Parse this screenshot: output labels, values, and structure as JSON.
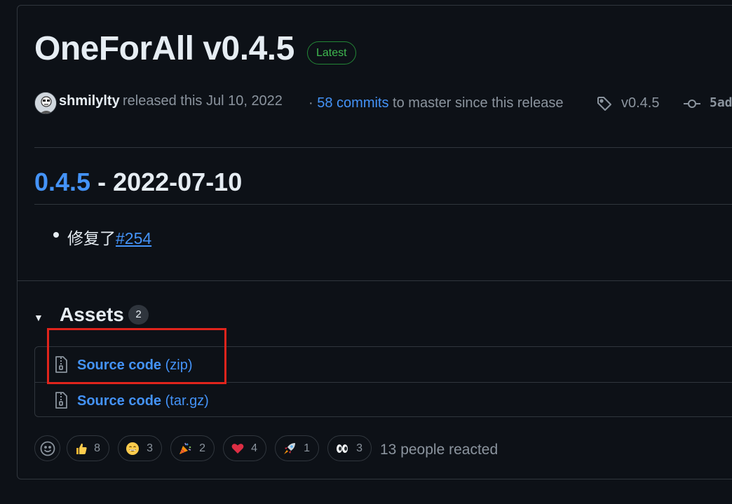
{
  "release": {
    "title": "OneForAll v0.4.5",
    "badge": "Latest",
    "author": "shmilylty",
    "released_text": "released this Jul 10, 2022",
    "commits_prefix": "·",
    "commits_link": "58 commits",
    "commits_suffix": "to master since this release",
    "tag": "v0.4.5",
    "commit_sha": "5ad"
  },
  "notes": {
    "version_link": "0.4.5",
    "version_date": " - 2022-07-10",
    "item_text": "修复了",
    "item_link": "#254"
  },
  "assets": {
    "title": "Assets",
    "count": "2",
    "items": [
      {
        "name": "Source code",
        "ext": "(zip)"
      },
      {
        "name": "Source code",
        "ext": "(tar.gz)"
      }
    ]
  },
  "reactions": {
    "items": [
      {
        "icon": "thumbs-up-icon",
        "count": "8"
      },
      {
        "icon": "smile-icon",
        "count": "3"
      },
      {
        "icon": "tada-icon",
        "count": "2"
      },
      {
        "icon": "heart-icon",
        "count": "4"
      },
      {
        "icon": "rocket-icon",
        "count": "1"
      },
      {
        "icon": "eyes-icon",
        "count": "3"
      }
    ],
    "summary": "13 people reacted"
  },
  "colors": {
    "background": "#0d1117",
    "link": "#4493f8",
    "latest_badge": "#3fb950",
    "highlight_box": "#e0241c"
  }
}
